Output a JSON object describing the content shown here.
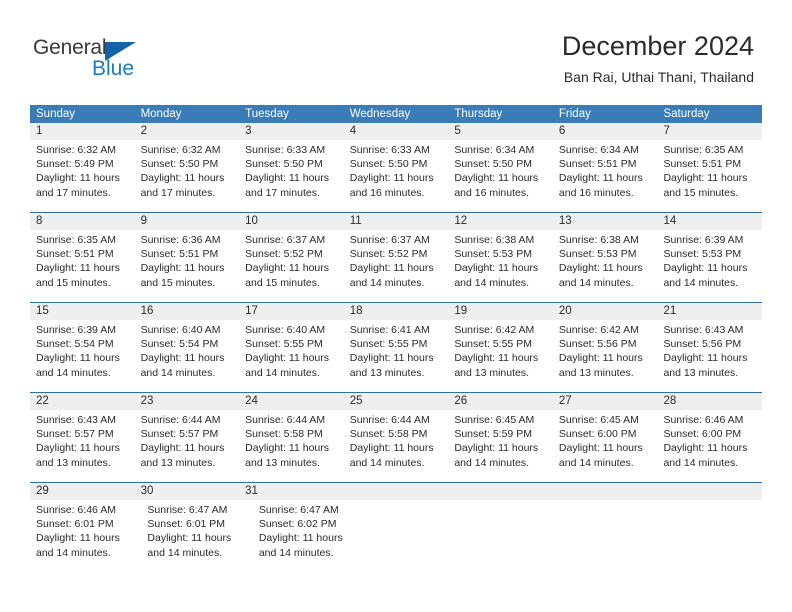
{
  "brand": {
    "name_part1": "General",
    "name_part2": "Blue",
    "primary_color": "#1b7bc4",
    "triangle_color": "#1463a8"
  },
  "header": {
    "title": "December 2024",
    "subtitle": "Ban Rai, Uthai Thani, Thailand"
  },
  "calendar": {
    "header_bg_color": "#3a7cb8",
    "daynum_bg_color": "#efefef",
    "weekdays": [
      "Sunday",
      "Monday",
      "Tuesday",
      "Wednesday",
      "Thursday",
      "Friday",
      "Saturday"
    ],
    "weeks": [
      {
        "days": [
          {
            "num": "1",
            "sunrise": "Sunrise: 6:32 AM",
            "sunset": "Sunset: 5:49 PM",
            "daylight": "Daylight: 11 hours and 17 minutes."
          },
          {
            "num": "2",
            "sunrise": "Sunrise: 6:32 AM",
            "sunset": "Sunset: 5:50 PM",
            "daylight": "Daylight: 11 hours and 17 minutes."
          },
          {
            "num": "3",
            "sunrise": "Sunrise: 6:33 AM",
            "sunset": "Sunset: 5:50 PM",
            "daylight": "Daylight: 11 hours and 17 minutes."
          },
          {
            "num": "4",
            "sunrise": "Sunrise: 6:33 AM",
            "sunset": "Sunset: 5:50 PM",
            "daylight": "Daylight: 11 hours and 16 minutes."
          },
          {
            "num": "5",
            "sunrise": "Sunrise: 6:34 AM",
            "sunset": "Sunset: 5:50 PM",
            "daylight": "Daylight: 11 hours and 16 minutes."
          },
          {
            "num": "6",
            "sunrise": "Sunrise: 6:34 AM",
            "sunset": "Sunset: 5:51 PM",
            "daylight": "Daylight: 11 hours and 16 minutes."
          },
          {
            "num": "7",
            "sunrise": "Sunrise: 6:35 AM",
            "sunset": "Sunset: 5:51 PM",
            "daylight": "Daylight: 11 hours and 15 minutes."
          }
        ]
      },
      {
        "days": [
          {
            "num": "8",
            "sunrise": "Sunrise: 6:35 AM",
            "sunset": "Sunset: 5:51 PM",
            "daylight": "Daylight: 11 hours and 15 minutes."
          },
          {
            "num": "9",
            "sunrise": "Sunrise: 6:36 AM",
            "sunset": "Sunset: 5:51 PM",
            "daylight": "Daylight: 11 hours and 15 minutes."
          },
          {
            "num": "10",
            "sunrise": "Sunrise: 6:37 AM",
            "sunset": "Sunset: 5:52 PM",
            "daylight": "Daylight: 11 hours and 15 minutes."
          },
          {
            "num": "11",
            "sunrise": "Sunrise: 6:37 AM",
            "sunset": "Sunset: 5:52 PM",
            "daylight": "Daylight: 11 hours and 14 minutes."
          },
          {
            "num": "12",
            "sunrise": "Sunrise: 6:38 AM",
            "sunset": "Sunset: 5:53 PM",
            "daylight": "Daylight: 11 hours and 14 minutes."
          },
          {
            "num": "13",
            "sunrise": "Sunrise: 6:38 AM",
            "sunset": "Sunset: 5:53 PM",
            "daylight": "Daylight: 11 hours and 14 minutes."
          },
          {
            "num": "14",
            "sunrise": "Sunrise: 6:39 AM",
            "sunset": "Sunset: 5:53 PM",
            "daylight": "Daylight: 11 hours and 14 minutes."
          }
        ]
      },
      {
        "days": [
          {
            "num": "15",
            "sunrise": "Sunrise: 6:39 AM",
            "sunset": "Sunset: 5:54 PM",
            "daylight": "Daylight: 11 hours and 14 minutes."
          },
          {
            "num": "16",
            "sunrise": "Sunrise: 6:40 AM",
            "sunset": "Sunset: 5:54 PM",
            "daylight": "Daylight: 11 hours and 14 minutes."
          },
          {
            "num": "17",
            "sunrise": "Sunrise: 6:40 AM",
            "sunset": "Sunset: 5:55 PM",
            "daylight": "Daylight: 11 hours and 14 minutes."
          },
          {
            "num": "18",
            "sunrise": "Sunrise: 6:41 AM",
            "sunset": "Sunset: 5:55 PM",
            "daylight": "Daylight: 11 hours and 13 minutes."
          },
          {
            "num": "19",
            "sunrise": "Sunrise: 6:42 AM",
            "sunset": "Sunset: 5:55 PM",
            "daylight": "Daylight: 11 hours and 13 minutes."
          },
          {
            "num": "20",
            "sunrise": "Sunrise: 6:42 AM",
            "sunset": "Sunset: 5:56 PM",
            "daylight": "Daylight: 11 hours and 13 minutes."
          },
          {
            "num": "21",
            "sunrise": "Sunrise: 6:43 AM",
            "sunset": "Sunset: 5:56 PM",
            "daylight": "Daylight: 11 hours and 13 minutes."
          }
        ]
      },
      {
        "days": [
          {
            "num": "22",
            "sunrise": "Sunrise: 6:43 AM",
            "sunset": "Sunset: 5:57 PM",
            "daylight": "Daylight: 11 hours and 13 minutes."
          },
          {
            "num": "23",
            "sunrise": "Sunrise: 6:44 AM",
            "sunset": "Sunset: 5:57 PM",
            "daylight": "Daylight: 11 hours and 13 minutes."
          },
          {
            "num": "24",
            "sunrise": "Sunrise: 6:44 AM",
            "sunset": "Sunset: 5:58 PM",
            "daylight": "Daylight: 11 hours and 13 minutes."
          },
          {
            "num": "25",
            "sunrise": "Sunrise: 6:44 AM",
            "sunset": "Sunset: 5:58 PM",
            "daylight": "Daylight: 11 hours and 14 minutes."
          },
          {
            "num": "26",
            "sunrise": "Sunrise: 6:45 AM",
            "sunset": "Sunset: 5:59 PM",
            "daylight": "Daylight: 11 hours and 14 minutes."
          },
          {
            "num": "27",
            "sunrise": "Sunrise: 6:45 AM",
            "sunset": "Sunset: 6:00 PM",
            "daylight": "Daylight: 11 hours and 14 minutes."
          },
          {
            "num": "28",
            "sunrise": "Sunrise: 6:46 AM",
            "sunset": "Sunset: 6:00 PM",
            "daylight": "Daylight: 11 hours and 14 minutes."
          }
        ]
      },
      {
        "days": [
          {
            "num": "29",
            "sunrise": "Sunrise: 6:46 AM",
            "sunset": "Sunset: 6:01 PM",
            "daylight": "Daylight: 11 hours and 14 minutes."
          },
          {
            "num": "30",
            "sunrise": "Sunrise: 6:47 AM",
            "sunset": "Sunset: 6:01 PM",
            "daylight": "Daylight: 11 hours and 14 minutes."
          },
          {
            "num": "31",
            "sunrise": "Sunrise: 6:47 AM",
            "sunset": "Sunset: 6:02 PM",
            "daylight": "Daylight: 11 hours and 14 minutes."
          }
        ]
      }
    ]
  }
}
